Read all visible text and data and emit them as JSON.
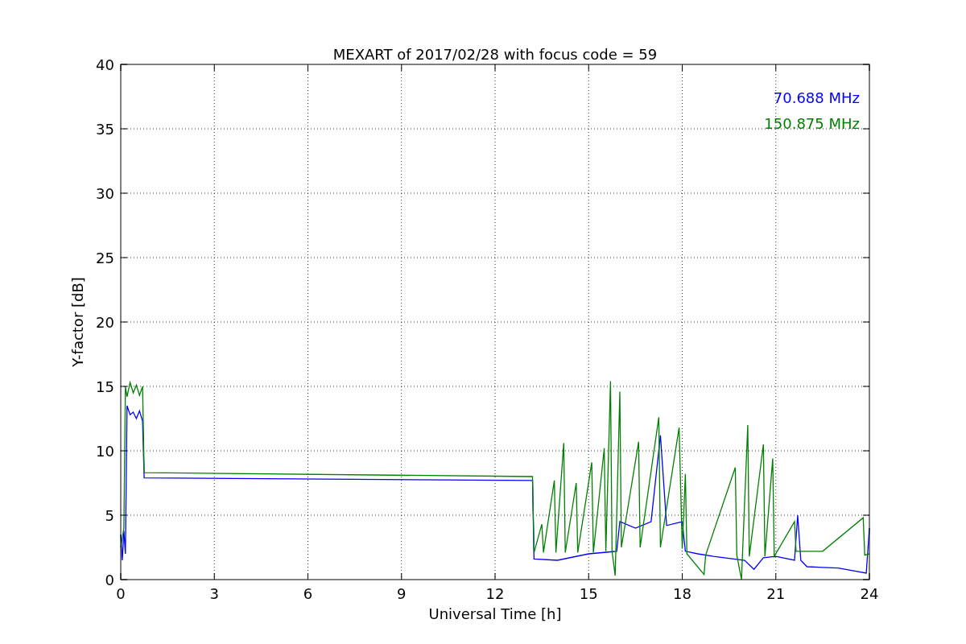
{
  "figure": {
    "chart_data": {
      "type": "line",
      "grid": true,
      "title": "MEXART of 2017/02/28 with focus code = 59",
      "xlabel": "Universal Time [h]",
      "ylabel": "Y-factor [dB]",
      "xlim": [
        0,
        24
      ],
      "ylim": [
        0,
        40
      ],
      "xticks": [
        0,
        3,
        6,
        9,
        12,
        15,
        18,
        21,
        24
      ],
      "yticks": [
        0,
        5,
        10,
        15,
        20,
        25,
        30,
        35,
        40
      ],
      "series": [
        {
          "name": "70.688 MHz",
          "color": "#0000ff",
          "x": [
            0,
            0.05,
            0.1,
            0.15,
            0.2,
            0.3,
            0.4,
            0.5,
            0.6,
            0.7,
            0.75,
            13.2,
            13.25,
            14,
            15,
            15.9,
            16,
            16.5,
            17,
            17.3,
            17.5,
            18,
            18.1,
            18.5,
            19,
            20,
            20.3,
            20.6,
            21,
            21.6,
            21.7,
            21.8,
            22,
            23,
            23.9,
            24
          ],
          "values": [
            3.5,
            1.5,
            3.8,
            2,
            13.5,
            12.8,
            13,
            12.5,
            13.1,
            12.3,
            7.9,
            7.7,
            1.6,
            1.5,
            2,
            2.2,
            4.5,
            4,
            4.5,
            11.2,
            4.2,
            4.5,
            2.2,
            2,
            1.8,
            1.5,
            0.8,
            1.7,
            1.8,
            1.5,
            5,
            1.5,
            1,
            0.9,
            0.5,
            4
          ]
        },
        {
          "name": "150.875 MHz",
          "color": "#008000",
          "x": [
            0,
            0.1,
            0.15,
            0.2,
            0.3,
            0.4,
            0.5,
            0.6,
            0.7,
            0.75,
            13.2,
            13.25,
            13.5,
            13.55,
            13.9,
            13.95,
            14.2,
            14.25,
            14.6,
            14.65,
            15.1,
            15.15,
            15.5,
            15.55,
            15.7,
            15.75,
            15.85,
            16,
            16.05,
            16.6,
            16.65,
            17.25,
            17.3,
            17.9,
            18,
            18.1,
            18.15,
            18.7,
            18.75,
            19.7,
            19.75,
            19.9,
            20.1,
            20.15,
            20.6,
            20.65,
            20.9,
            20.95,
            21.6,
            21.65,
            22.5,
            23.8,
            23.85,
            24
          ],
          "values": [
            2.5,
            4,
            15,
            14.2,
            15.3,
            14.5,
            15.1,
            14.3,
            15,
            8.3,
            8,
            2.1,
            4.3,
            2.1,
            7.7,
            2.1,
            10.6,
            2.1,
            7.5,
            2.1,
            9.1,
            2.1,
            10.2,
            2.2,
            15.4,
            2.2,
            0.3,
            14.6,
            2.5,
            10.7,
            2.5,
            12.6,
            2.5,
            11.8,
            2.4,
            8.2,
            2,
            0.4,
            1.9,
            8.7,
            1.9,
            0,
            12,
            1.8,
            10.5,
            1.8,
            9.4,
            1.8,
            4.5,
            2.2,
            2.2,
            4.8,
            1.9,
            2
          ]
        }
      ]
    }
  }
}
